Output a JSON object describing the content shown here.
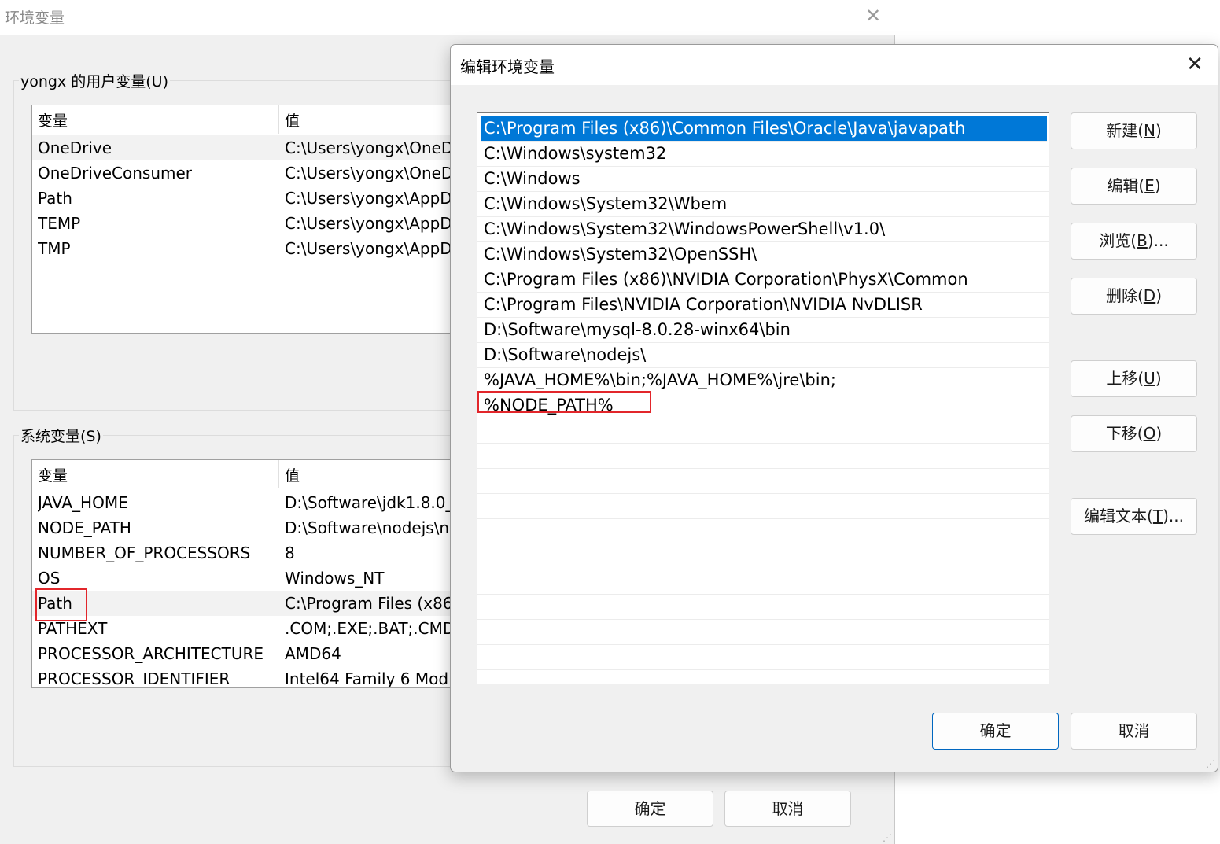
{
  "env_window": {
    "title": "环境变量",
    "close_glyph": "✕",
    "user_group_label": "yongx 的用户变量(U)",
    "system_group_label": "系统变量(S)",
    "column_variable": "变量",
    "column_value": "值",
    "user_vars": [
      {
        "name": "OneDrive",
        "value": "C:\\Users\\yongx\\OneD"
      },
      {
        "name": "OneDriveConsumer",
        "value": "C:\\Users\\yongx\\OneD"
      },
      {
        "name": "Path",
        "value": "C:\\Users\\yongx\\AppD"
      },
      {
        "name": "TEMP",
        "value": "C:\\Users\\yongx\\AppD"
      },
      {
        "name": "TMP",
        "value": "C:\\Users\\yongx\\AppD"
      }
    ],
    "system_vars": [
      {
        "name": "JAVA_HOME",
        "value": "D:\\Software\\jdk1.8.0_"
      },
      {
        "name": "NODE_PATH",
        "value": "D:\\Software\\nodejs\\n"
      },
      {
        "name": "NUMBER_OF_PROCESSORS",
        "value": "8"
      },
      {
        "name": "OS",
        "value": "Windows_NT"
      },
      {
        "name": "Path",
        "value": "C:\\Program Files (x86"
      },
      {
        "name": "PATHEXT",
        "value": ".COM;.EXE;.BAT;.CMD"
      },
      {
        "name": "PROCESSOR_ARCHITECTURE",
        "value": "AMD64"
      },
      {
        "name": "PROCESSOR_IDENTIFIER",
        "value": "Intel64 Family 6 Mod"
      }
    ],
    "ok_label": "确定",
    "cancel_label": "取消"
  },
  "edit_dialog": {
    "title": "编辑环境变量",
    "close_glyph": "✕",
    "paths": [
      "C:\\Program Files (x86)\\Common Files\\Oracle\\Java\\javapath",
      "C:\\Windows\\system32",
      "C:\\Windows",
      "C:\\Windows\\System32\\Wbem",
      "C:\\Windows\\System32\\WindowsPowerShell\\v1.0\\",
      "C:\\Windows\\System32\\OpenSSH\\",
      "C:\\Program Files (x86)\\NVIDIA Corporation\\PhysX\\Common",
      "C:\\Program Files\\NVIDIA Corporation\\NVIDIA NvDLISR",
      "D:\\Software\\mysql-8.0.28-winx64\\bin",
      "D:\\Software\\nodejs\\",
      "%JAVA_HOME%\\bin;%JAVA_HOME%\\jre\\bin;",
      "%NODE_PATH%"
    ],
    "buttons": {
      "new": {
        "text": "新建(",
        "key": "N",
        "tail": ")"
      },
      "edit": {
        "text": "编辑(",
        "key": "E",
        "tail": ")"
      },
      "browse": {
        "text": "浏览(",
        "key": "B",
        "tail": ")..."
      },
      "delete": {
        "text": "删除(",
        "key": "D",
        "tail": ")"
      },
      "move_up": {
        "text": "上移(",
        "key": "U",
        "tail": ")"
      },
      "move_down": {
        "text": "下移(",
        "key": "O",
        "tail": ")"
      },
      "edit_text": {
        "text": "编辑文本(",
        "key": "T",
        "tail": ")..."
      }
    },
    "ok_label": "确定",
    "cancel_label": "取消"
  },
  "colors": {
    "selection": "#0078d7",
    "annotation": "#e2262b",
    "default_button_border": "#0067c0"
  }
}
